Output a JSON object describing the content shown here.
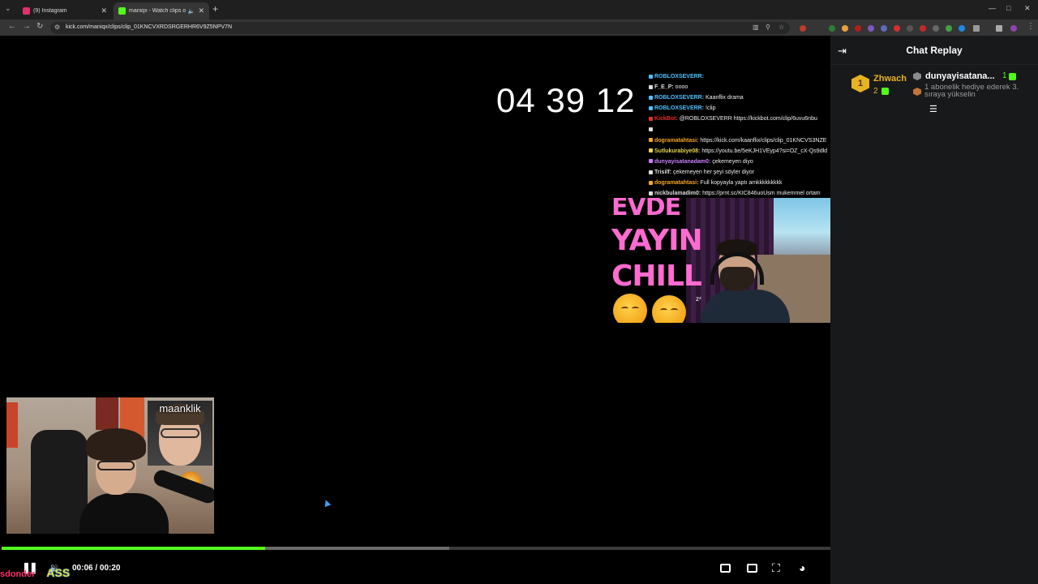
{
  "browser": {
    "tabs": [
      {
        "title": "(9) Instagram",
        "favicon_color": "#e1306c"
      },
      {
        "title": "maniqx - Watch clips on Ki",
        "favicon_color": "#53fc18"
      }
    ],
    "url": "kick.com/maniqx/clips/clip_01KNCVXRDSRGERHR6V9Z5NPV7N"
  },
  "video": {
    "clock": "04 39 12",
    "chat_overlay": [
      {
        "user": "ROBLOXSEVERR:",
        "user_color": "#4cc2ff",
        "text": ""
      },
      {
        "user": "F_E_P:",
        "user_color": "#dddddd",
        "text": " oooo"
      },
      {
        "user": "ROBLOXSEVERR:",
        "user_color": "#4cc2ff",
        "text": " Kaanflix drama"
      },
      {
        "user": "ROBLOXSEVERR:",
        "user_color": "#4cc2ff",
        "text": " !clip"
      },
      {
        "user": "KickBot:",
        "user_color": "#e3312c",
        "text": " @ROBLOXSEVERR https://kickbot.com/clip/6uvu6nbu"
      },
      {
        "user": "",
        "user_color": "#dddddd",
        "text": ""
      },
      {
        "user": "dogramatahtasi:",
        "user_color": "#f5a623",
        "text": " https://kick.com/kaanflix/clips/clip_01KNCVS3NZE"
      },
      {
        "user": "Sutlukurabiye08:",
        "user_color": "#e8d44d",
        "text": " https://youtu.be/5eKJH1VEyp4?si=OZ_cX-Qs9dld"
      },
      {
        "user": "dunyayisatanadam0:",
        "user_color": "#c880ff",
        "text": " çekemeyen diyo"
      },
      {
        "user": "Trisilf:",
        "user_color": "#dddddd",
        "text": " çekemeyen her şeyi söyler diyor"
      },
      {
        "user": "dogramatahtasi:",
        "user_color": "#f5a623",
        "text": " Full kopyayla yaptı amkkkkkkkkk"
      },
      {
        "user": "nickbulamadim0:",
        "user_color": "#dddddd",
        "text": " https://prnt.sc/KtC846uoUsm mukemmel ortam"
      }
    ],
    "banner_words": [
      "EVDE",
      "YAYIN",
      "CHILL"
    ],
    "inset_label": "maanklik",
    "overlay_logo": "sdonder",
    "overlay_logo_suffix": "ASS"
  },
  "player": {
    "current_time": "00:06",
    "separator": "/",
    "duration": "00:20",
    "progress_fraction": 0.318,
    "buffered_fraction": 0.54,
    "accent_color": "#53fc18"
  },
  "chat_panel": {
    "title": "Chat Replay",
    "leaderboard": [
      {
        "rank": "1",
        "name": "Zhwach",
        "name_color": "#e7b320",
        "count": "2"
      },
      {
        "rank": "",
        "name": "dunyayisatana...",
        "name_color": "#ffffff",
        "count": "1"
      }
    ],
    "promo_text": "1 abonelik hediye ederek 3. sıraya yükselin"
  }
}
